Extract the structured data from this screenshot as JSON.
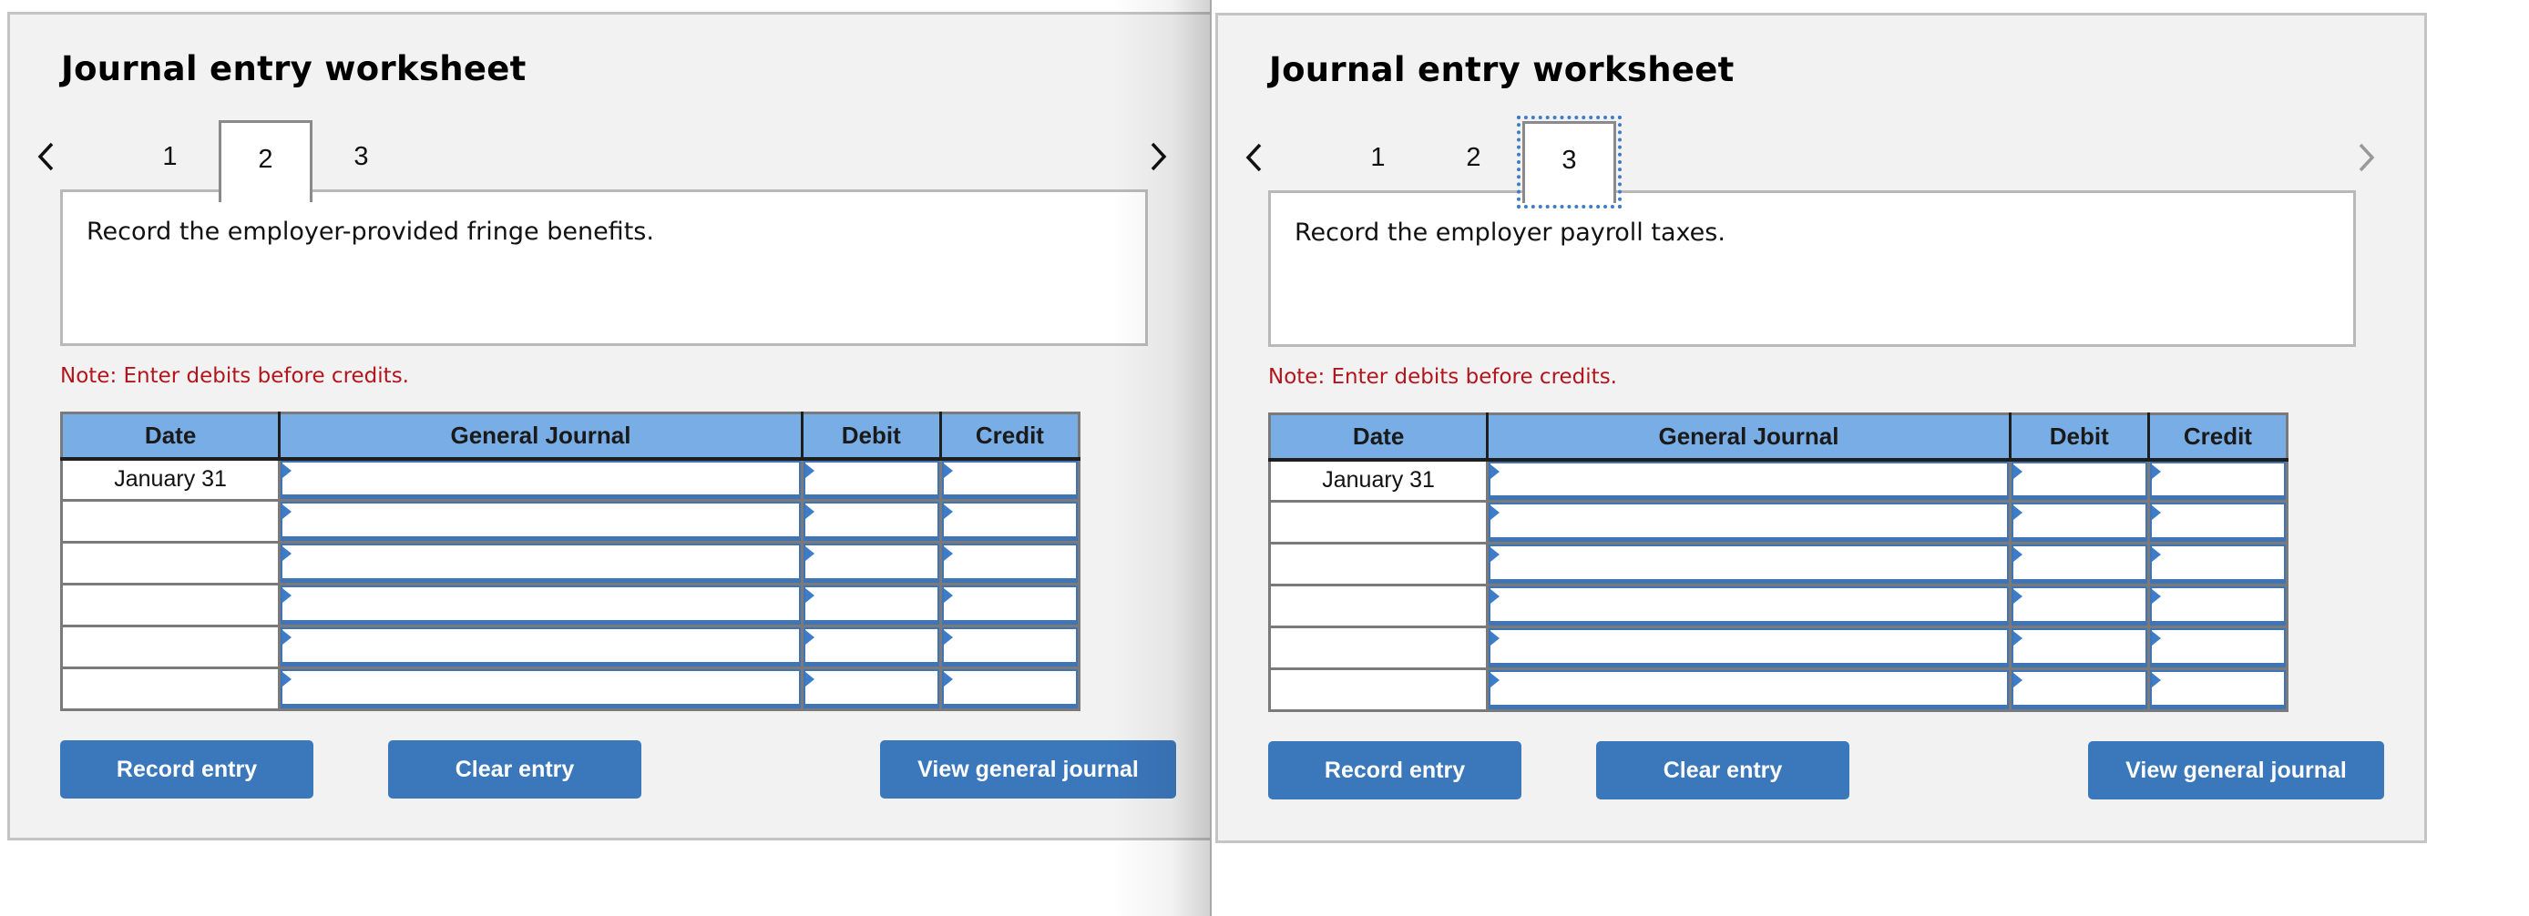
{
  "panels": [
    {
      "title": "Journal entry worksheet",
      "nav": {
        "prev_icon": "chevron-left-icon",
        "next_icon": "chevron-right-icon",
        "next_enabled": true,
        "tabs": [
          "1",
          "2",
          "3"
        ],
        "active_tab": "2"
      },
      "prompt": "Record the employer-provided fringe benefits.",
      "note": "Note: Enter debits before credits.",
      "table": {
        "headers": [
          "Date",
          "General Journal",
          "Debit",
          "Credit"
        ],
        "rows": [
          {
            "date": "January 31",
            "account": "",
            "debit": "",
            "credit": ""
          },
          {
            "date": "",
            "account": "",
            "debit": "",
            "credit": ""
          },
          {
            "date": "",
            "account": "",
            "debit": "",
            "credit": ""
          },
          {
            "date": "",
            "account": "",
            "debit": "",
            "credit": ""
          },
          {
            "date": "",
            "account": "",
            "debit": "",
            "credit": ""
          },
          {
            "date": "",
            "account": "",
            "debit": "",
            "credit": ""
          }
        ]
      },
      "buttons": {
        "record": "Record entry",
        "clear": "Clear entry",
        "view": "View general journal"
      }
    },
    {
      "title": "Journal entry worksheet",
      "nav": {
        "prev_icon": "chevron-left-icon",
        "next_icon": "chevron-right-icon",
        "next_enabled": false,
        "tabs": [
          "1",
          "2",
          "3"
        ],
        "active_tab": "3"
      },
      "prompt": "Record the employer payroll taxes.",
      "note": "Note: Enter debits before credits.",
      "table": {
        "headers": [
          "Date",
          "General Journal",
          "Debit",
          "Credit"
        ],
        "rows": [
          {
            "date": "January 31",
            "account": "",
            "debit": "",
            "credit": ""
          },
          {
            "date": "",
            "account": "",
            "debit": "",
            "credit": ""
          },
          {
            "date": "",
            "account": "",
            "debit": "",
            "credit": ""
          },
          {
            "date": "",
            "account": "",
            "debit": "",
            "credit": ""
          },
          {
            "date": "",
            "account": "",
            "debit": "",
            "credit": ""
          },
          {
            "date": "",
            "account": "",
            "debit": "",
            "credit": ""
          }
        ]
      },
      "buttons": {
        "record": "Record entry",
        "clear": "Clear entry",
        "view": "View general journal"
      }
    }
  ],
  "colors": {
    "panel_bg": "#f2f2f2",
    "header_blue": "#78ade6",
    "button_blue": "#3b77bb",
    "note_red": "#b3151c",
    "input_border": "#3f74b7",
    "focus_ring": "#3d7cc9",
    "disabled_arrow": "#999999"
  }
}
